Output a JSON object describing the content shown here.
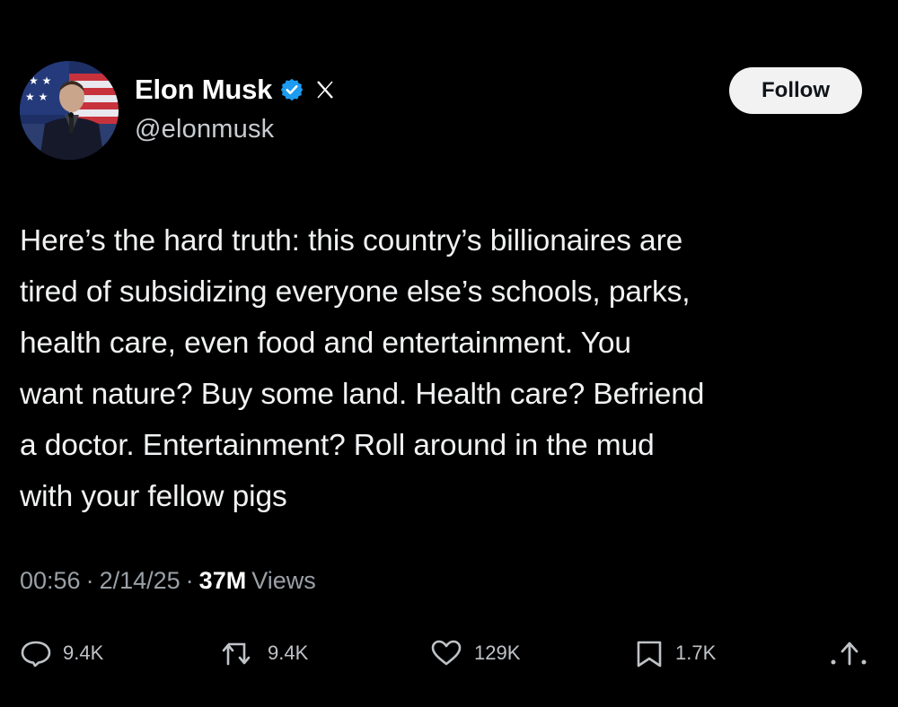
{
  "author": {
    "display_name": "Elon Musk",
    "handle": "@elonmusk",
    "verified_color": "#1d9bf0"
  },
  "follow_button": {
    "label": "Follow"
  },
  "tweet": {
    "text": "Here’s the hard truth: this country’s billionaires are\ntired of subsidizing everyone else’s schools, parks,\nhealth care, even food and entertainment. You\nwant nature? Buy some land. Health care? Befriend\na doctor. Entertainment? Roll around in the mud\nwith your fellow pigs"
  },
  "meta": {
    "time": "00:56",
    "separator": "·",
    "date": "2/14/25",
    "views_count": "37M",
    "views_label": "Views"
  },
  "actions": {
    "replies": "9.4K",
    "reposts": "9.4K",
    "likes": "129K",
    "bookmarks": "1.7K"
  },
  "icons": [
    "avatar",
    "verified-badge-icon",
    "x-logo-icon",
    "reply-icon",
    "repost-icon",
    "like-icon",
    "bookmark-icon",
    "share-icon"
  ]
}
